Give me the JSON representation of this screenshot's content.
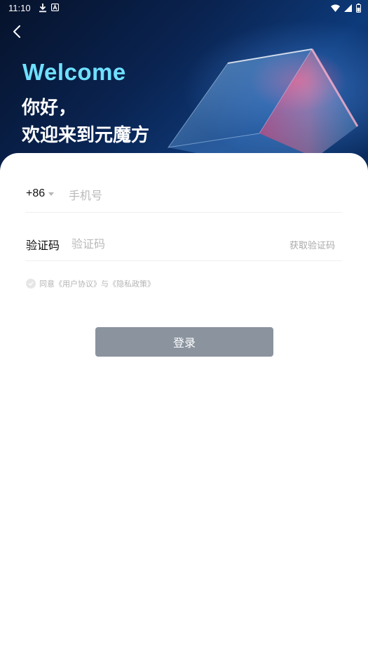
{
  "status_bar": {
    "time": "11:10"
  },
  "header": {
    "welcome": "Welcome",
    "greeting_line1": "你好，",
    "greeting_line2": "欢迎来到元魔方"
  },
  "form": {
    "country_code": "+86",
    "phone_placeholder": "手机号",
    "code_label": "验证码",
    "code_placeholder": "验证码",
    "get_code_label": "获取验证码"
  },
  "agreement": {
    "prefix": "同意",
    "user_agreement": "《用户协议》",
    "connector": "与",
    "privacy_policy": "《隐私政策》"
  },
  "login_button": "登录",
  "colors": {
    "welcome_accent": "#6fe0ff",
    "login_button_bg": "#8a939e",
    "hero_bg": "#0a2350"
  },
  "icons": [
    "back-arrow-icon",
    "download-icon",
    "notification-a-icon",
    "wifi-icon",
    "signal-icon",
    "battery-icon",
    "caret-down-icon",
    "check-circle-icon"
  ]
}
